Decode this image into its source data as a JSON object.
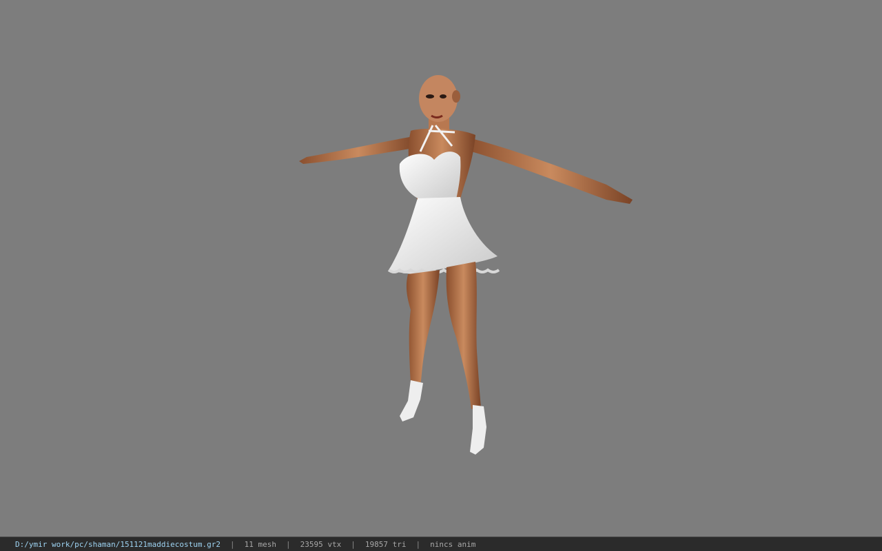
{
  "viewer": {
    "background_color": "#7d7d7d"
  },
  "model": {
    "icon": "character-model"
  },
  "status_bar": {
    "file_path": "D:/ymir work/pc/shaman/151121maddiecostum.gr2",
    "separator": "|",
    "mesh_count": "11 mesh",
    "vertex_count": "23595 vtx",
    "triangle_count": "19857 tri",
    "animation": "nincs anim"
  }
}
